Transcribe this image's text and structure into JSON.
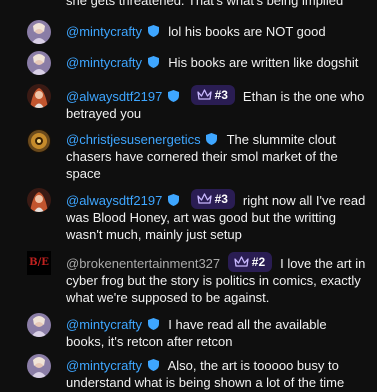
{
  "top_fragment": "she gets threatened. That's what's being implied",
  "messages": [
    {
      "author": "@mintycrafty",
      "verified": true,
      "rank": "",
      "text": "lol his books are NOT good"
    },
    {
      "author": "@mintycrafty",
      "verified": true,
      "rank": "",
      "text": "His books are written like dogshit"
    },
    {
      "author": "@alwaysdtf2197",
      "verified": true,
      "rank": "#3",
      "text": "Ethan is the one who betrayed you"
    },
    {
      "author": "@christjesusenergetics",
      "verified": true,
      "rank": "",
      "text": "The slummite clout chasers have cornered their smol market of the space"
    },
    {
      "author": "@alwaysdtf2197",
      "verified": true,
      "rank": "#3",
      "text": "right now all I've read was Blood Honey, art was good but the writting wasn't much, mainly just setup"
    },
    {
      "author": "@brokenentertainment327",
      "verified": false,
      "rank": "#2",
      "text": "I love the art in cyber frog but the story is politics in comics, exactly what we're supposed to be against."
    },
    {
      "author": "@mintycrafty",
      "verified": true,
      "rank": "",
      "text": "I have read all the available books, it's retcon after retcon"
    },
    {
      "author": "@mintycrafty",
      "verified": true,
      "rank": "",
      "text": "Also, the art is tooooo busy to understand what is being shown a lot of the time"
    }
  ],
  "avatars": {
    "mintycrafty": "avatar-photo",
    "alwaysdtf2197": "avatar-photo",
    "christjesusenergetics": "eye-avatar",
    "brokenentertainment327": "B/E",
    "be_color": "#c0211f"
  },
  "colors": {
    "verified_author": "#3ea6ff",
    "plain_author": "#aaaaaa",
    "rank_badge_bg": "#2a1d53",
    "background": "#0f0f0f"
  }
}
